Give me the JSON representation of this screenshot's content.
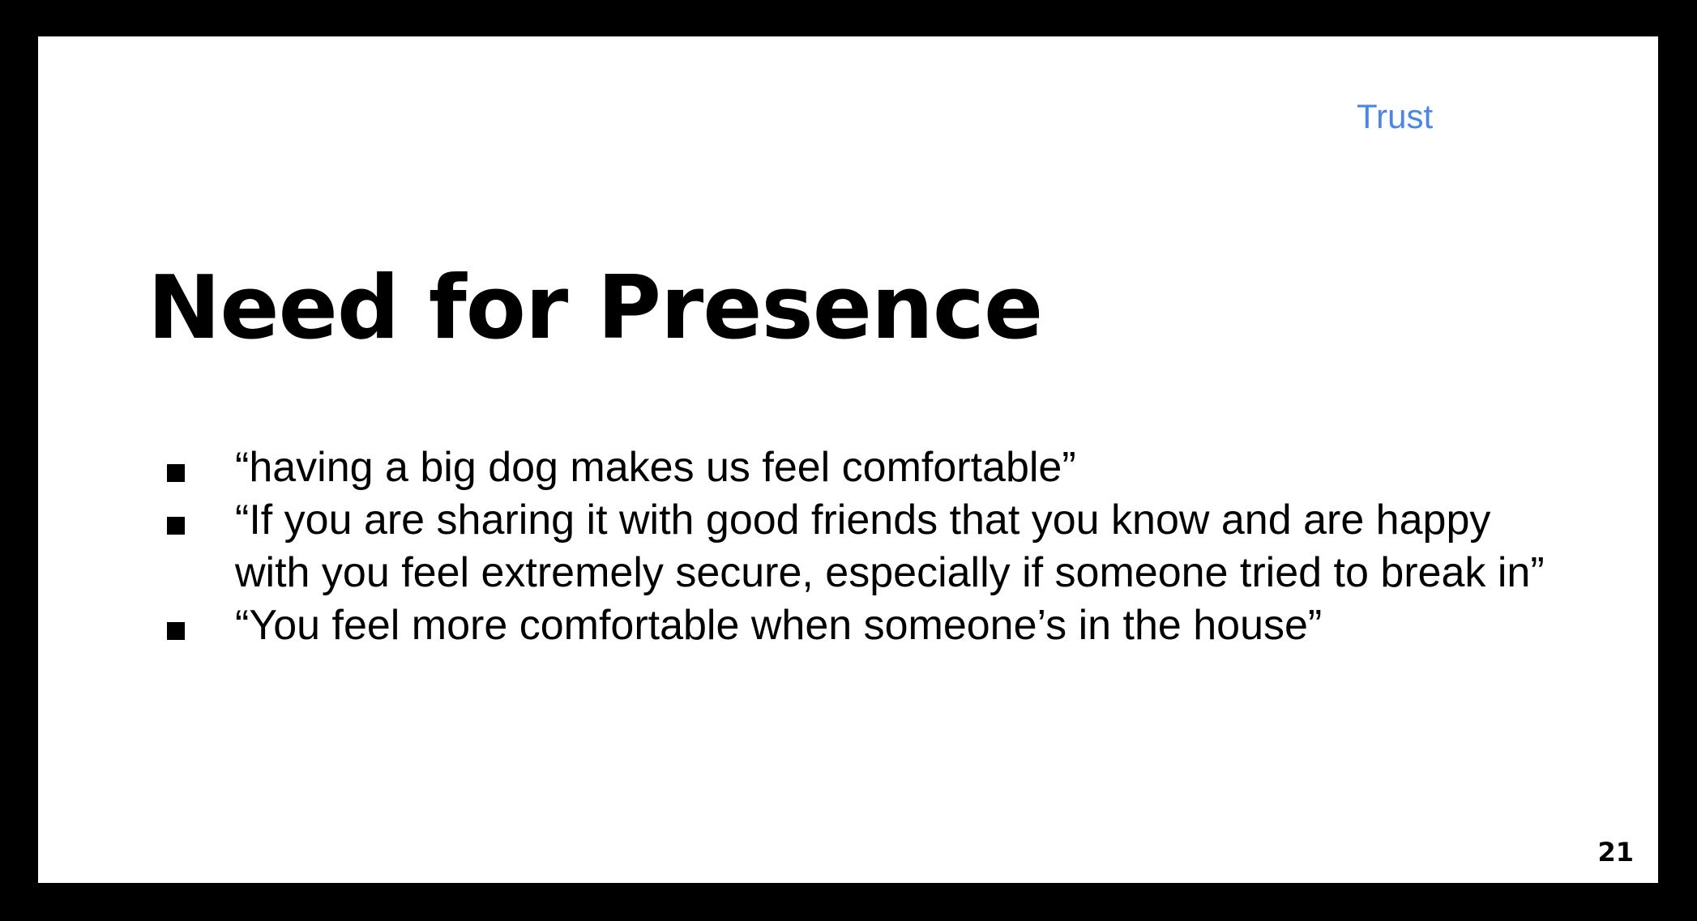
{
  "slide": {
    "section_tag": "Trust",
    "title": "Need for Presence",
    "bullets": [
      "“having a big dog makes us feel comfortable”",
      "“If you are sharing it with good friends that you know and are happy with you feel extremely secure, especially if someone tried to break in”",
      "“You feel more comfortable when someone’s in the house”"
    ],
    "page_number": "21"
  },
  "colors": {
    "background": "#000000",
    "slide": "#ffffff",
    "accent_link": "#4a86e8",
    "text": "#000000"
  },
  "icons": {
    "bullet": "square-bullet-icon"
  }
}
